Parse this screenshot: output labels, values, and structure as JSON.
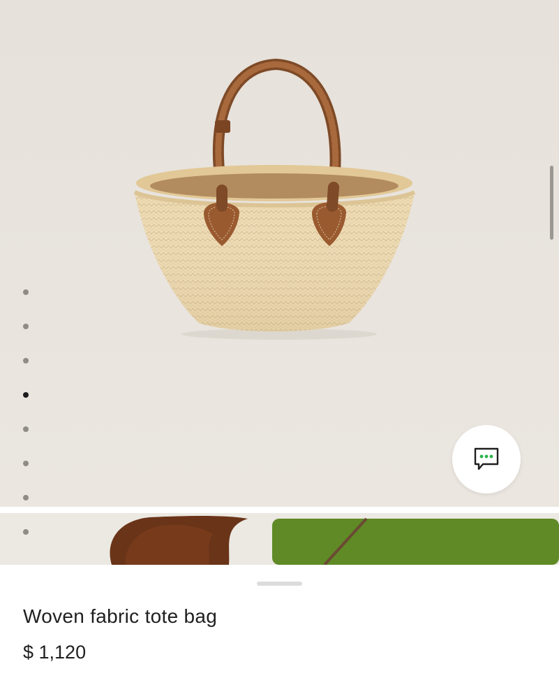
{
  "product": {
    "name": "Woven fabric tote bag",
    "price": "$ 1,120"
  },
  "gallery": {
    "image_count": 8,
    "active_index": 3,
    "main_image": "woven-tote-bag-photo",
    "next_image": "model-with-green-accent-photo"
  },
  "chat": {
    "icon": "chat-bubble-icon",
    "accent_color": "#2bb34a"
  },
  "colors": {
    "background": "#e9e3dc",
    "text": "#1f1f1f",
    "active_dot": "#1c1c1c",
    "inactive_dot": "#8f8b87"
  }
}
